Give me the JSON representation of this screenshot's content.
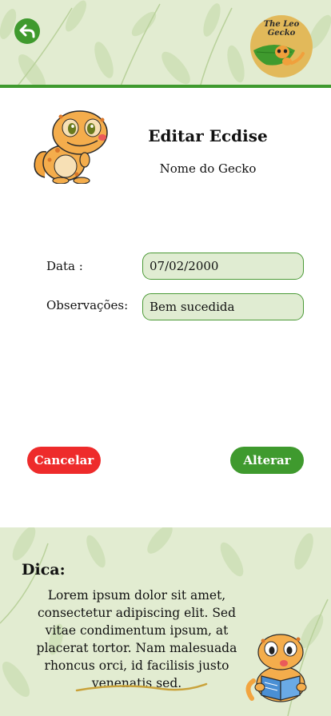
{
  "header": {
    "back_icon": "back-arrow-icon",
    "logo_text_line1": "The Leo",
    "logo_text_line2": "Gecko"
  },
  "page": {
    "title": "Editar Ecdise",
    "gecko_name": "Nome do Gecko"
  },
  "form": {
    "date_label": "Data :",
    "date_value": "07/02/2000",
    "notes_label": "Observações:",
    "notes_value": "Bem sucedida"
  },
  "actions": {
    "cancel_label": "Cancelar",
    "save_label": "Alterar"
  },
  "tip": {
    "title": "Dica:",
    "text": "Lorem ipsum dolor sit amet, consectetur adipiscing elit. Sed vitae condimentum ipsum, at placerat tortor. Nam malesuada rhoncus orci, id facilisis justo venenatis sed."
  },
  "colors": {
    "primary_green": "#3f9a2e",
    "danger_red": "#ee2b2b",
    "background_leaf": "#e2ecd1",
    "input_fill": "#e0ecd2"
  }
}
